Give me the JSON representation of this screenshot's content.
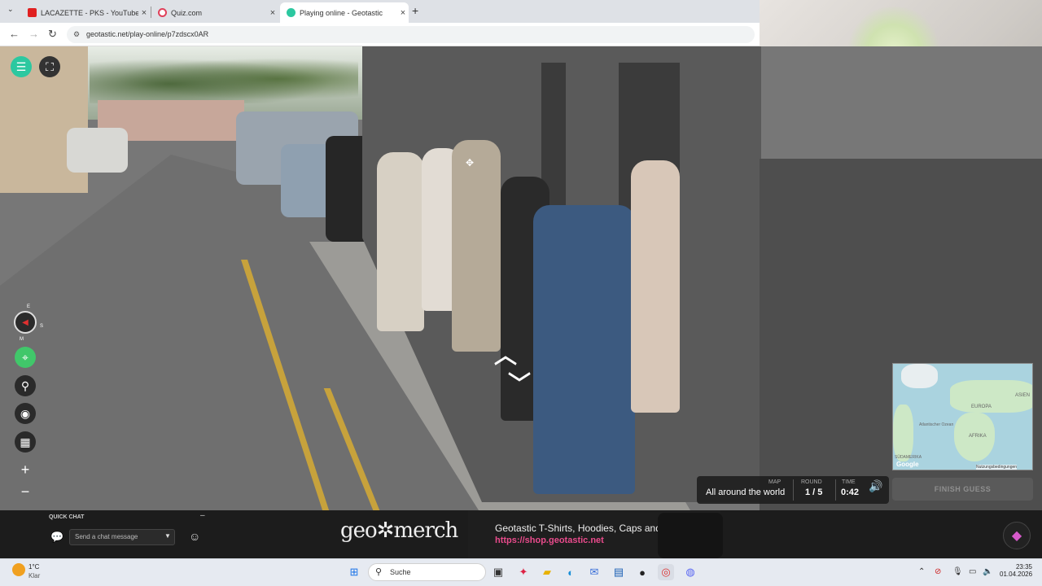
{
  "browser": {
    "tabs": [
      {
        "title": "LACAZETTE - PKS - YouTube",
        "favicon": "youtube-icon"
      },
      {
        "title": "Quiz.com",
        "favicon": "quiz-icon"
      },
      {
        "title": "Playing online - Geotastic",
        "favicon": "geotastic-icon"
      }
    ],
    "url": "geotastic.net/play-online/p7zdscx0AR"
  },
  "game": {
    "hud": {
      "map_label": "MAP",
      "map_value": "All around the world",
      "round_label": "ROUND",
      "round_value": "1 / 5",
      "time_label": "TIME",
      "time_value": "0:42"
    },
    "finish_label": "FINISH GUESS",
    "compass": {
      "n": "E",
      "s": "M",
      "e": "S"
    },
    "minimap": {
      "labels": [
        "EUROPA",
        "ASIEN",
        "AFRIKA",
        "Atlantischer Ozean",
        "SÜDAMERIKA"
      ],
      "attribution": "Nutzungsbedingungen",
      "logo": "Google"
    }
  },
  "chat": {
    "title": "QUICK CHAT",
    "placeholder": "Send a chat message",
    "minimize": "–"
  },
  "merch": {
    "logo": "geo✲merch",
    "title": "Geotastic T-Shirts, Hoodies, Caps and more!",
    "link": "https://shop.geotastic.net"
  },
  "taskbar": {
    "weather_temp": "1°C",
    "weather_desc": "Klar",
    "search": "Suche",
    "time": "23:35",
    "date": "01.04.2026"
  },
  "colors": {
    "accent": "#2cc8a0",
    "link": "#e94b8c",
    "green_btn": "#41c76a"
  }
}
